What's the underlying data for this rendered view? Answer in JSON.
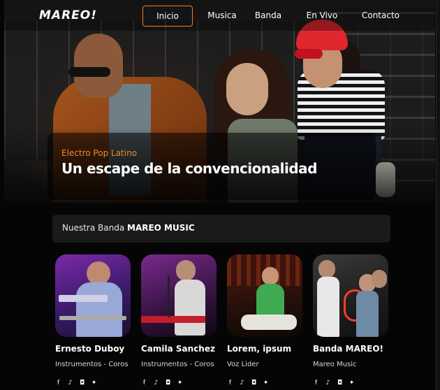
{
  "nav": {
    "logo": "MAREO!",
    "items": [
      {
        "label": "Inicio",
        "active": true
      },
      {
        "label": "Musica"
      },
      {
        "label": "Banda"
      },
      {
        "label": "En Vivo"
      },
      {
        "label": "Contacto"
      }
    ],
    "accent": "#f07b2a"
  },
  "hero": {
    "subtitle": "Electro Pop Latino",
    "title": "Un escape de la convencionalidad"
  },
  "band": {
    "label": "Nuestra Banda",
    "name": "MAREO MUSIC"
  },
  "members": [
    {
      "name": "Ernesto Duboy",
      "role": "Instrumentos - Coros",
      "social": [
        "facebook-icon",
        "tiktok-icon",
        "instagram-icon",
        "twitter-icon"
      ]
    },
    {
      "name": "Camila Sanchez",
      "role": "Instrumentos - Coros",
      "social": [
        "facebook-icon",
        "tiktok-icon",
        "instagram-icon",
        "twitter-icon"
      ]
    },
    {
      "name": "Lorem, ipsum",
      "role": "Voz Lider",
      "social": [
        "facebook-icon",
        "tiktok-icon",
        "instagram-icon",
        "twitter-icon"
      ]
    },
    {
      "name": "Banda MAREO!",
      "role": "Mareo Music",
      "social": [
        "facebook-icon",
        "tiktok-icon",
        "instagram-icon",
        "twitter-icon"
      ]
    }
  ]
}
